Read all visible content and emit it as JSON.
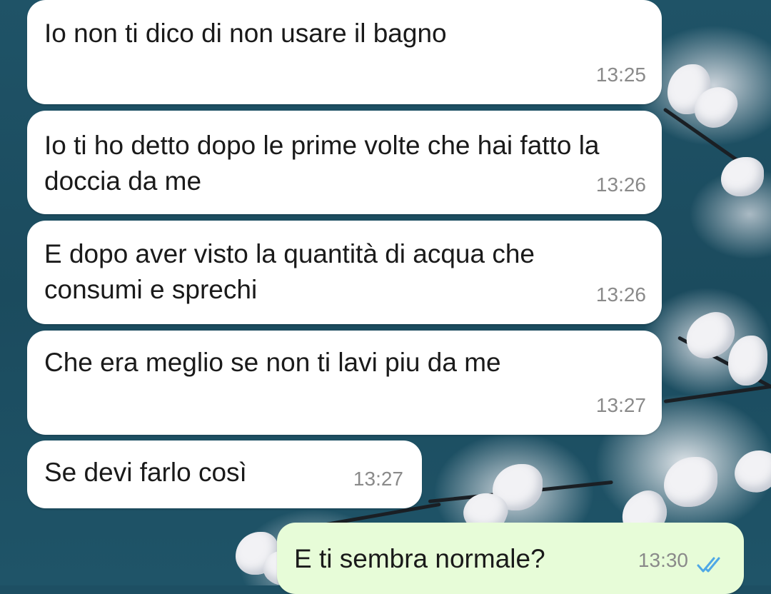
{
  "theme": {
    "incoming_bubble": "#ffffff",
    "outgoing_bubble": "#e7fcd8",
    "timestamp": "#8a8a8a",
    "read_ticks": "#4fa8e6",
    "wallpaper": "#1d4f63"
  },
  "messages": [
    {
      "direction": "incoming",
      "text": "Io non ti dico di non usare il bagno",
      "time": "13:25"
    },
    {
      "direction": "incoming",
      "text": "Io ti ho detto dopo le prime volte che hai fatto la doccia da me",
      "time": "13:26"
    },
    {
      "direction": "incoming",
      "text": "E dopo aver visto la quantità di acqua che consumi e sprechi",
      "time": "13:26"
    },
    {
      "direction": "incoming",
      "text": "Che era meglio se non ti lavi piu da me",
      "time": "13:27"
    },
    {
      "direction": "incoming",
      "text": "Se devi farlo così",
      "time": "13:27"
    },
    {
      "direction": "outgoing",
      "text": "E ti sembra normale?",
      "time": "13:30",
      "status_icon": "double-check-read-icon"
    }
  ]
}
